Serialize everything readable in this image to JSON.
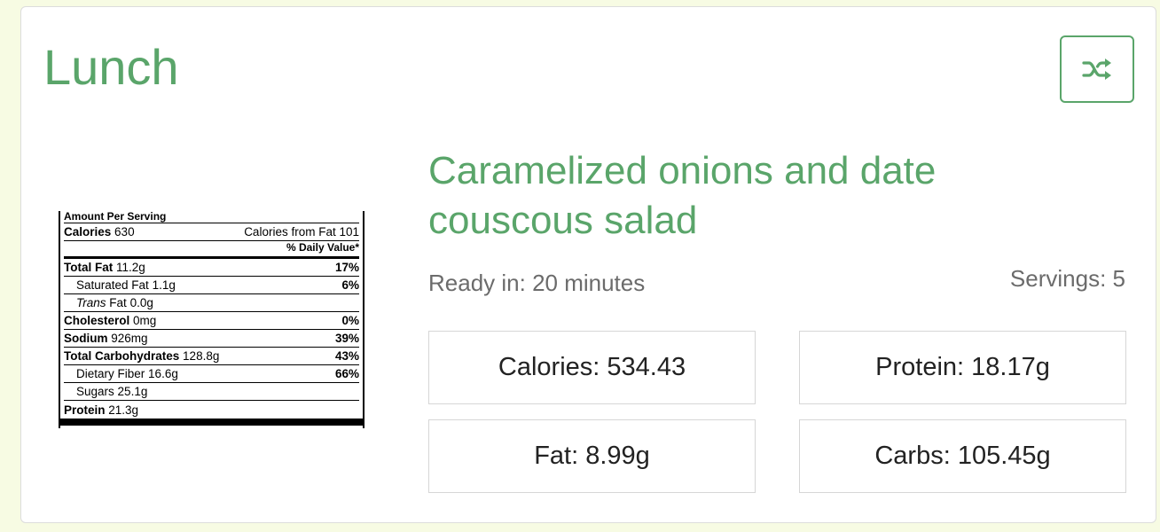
{
  "card": {
    "meal_title": "Lunch",
    "shuffle_button_icon": "shuffle-icon",
    "accent_color": "#5aa56a"
  },
  "nutrition_label": {
    "header": "Amount Per Serving",
    "calories_label": "Calories",
    "calories_value": "630",
    "calories_from_fat": "Calories from Fat 101",
    "daily_value_header": "% Daily Value*",
    "rows": [
      {
        "label": "Total Fat",
        "amount": "11.2g",
        "percent": "17%"
      },
      {
        "label": "Saturated Fat",
        "amount": "1.1g",
        "percent": "6%"
      },
      {
        "label_italic": "Trans",
        "label_rest": "Fat",
        "amount": "0.0g",
        "percent": ""
      },
      {
        "label": "Cholesterol",
        "amount": "0mg",
        "percent": "0%"
      },
      {
        "label": "Sodium",
        "amount": "926mg",
        "percent": "39%"
      },
      {
        "label": "Total Carbohydrates",
        "amount": "128.8g",
        "percent": "43%"
      },
      {
        "label": "Dietary Fiber",
        "amount": "16.6g",
        "percent": "66%"
      },
      {
        "label": "Sugars",
        "amount": "25.1g",
        "percent": ""
      },
      {
        "label": "Protein",
        "amount": "21.3g",
        "percent": ""
      }
    ]
  },
  "recipe": {
    "title": "Caramelized onions and date couscous salad",
    "ready_in": "Ready in: 20 minutes",
    "servings": "Servings: 5"
  },
  "stats": {
    "calories": "Calories: 534.43",
    "protein": "Protein: 18.17g",
    "fat": "Fat: 8.99g",
    "carbs": "Carbs: 105.45g"
  }
}
